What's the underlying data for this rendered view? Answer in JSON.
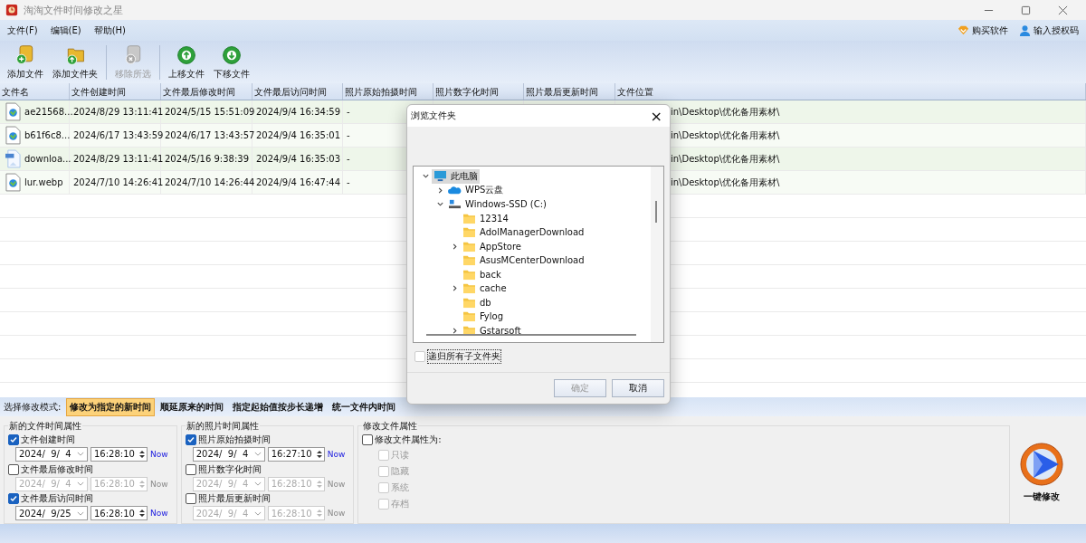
{
  "window": {
    "title": "淘淘文件时间修改之星"
  },
  "menu": [
    {
      "label": "文件(F)"
    },
    {
      "label": "编辑(E)"
    },
    {
      "label": "帮助(H)"
    }
  ],
  "menu_links": [
    {
      "kind": "buy",
      "label": "购买软件"
    },
    {
      "kind": "user",
      "label": "输入授权码"
    }
  ],
  "toolbar": [
    {
      "kind": "add-file",
      "label": "添加文件",
      "disabled": false
    },
    {
      "kind": "add-folder",
      "label": "添加文件夹",
      "disabled": false
    },
    {
      "kind": "remove",
      "label": "移除所选",
      "disabled": true
    },
    {
      "kind": "up",
      "label": "上移文件",
      "disabled": false
    },
    {
      "kind": "down",
      "label": "下移文件",
      "disabled": false
    }
  ],
  "table": {
    "columns": [
      "文件名",
      "文件创建时间",
      "文件最后修改时间",
      "文件最后访问时间",
      "照片原始拍摄时间",
      "照片数字化时间",
      "照片最后更新时间",
      "文件位置"
    ],
    "rows": [
      {
        "kind": "image",
        "name": "ae21568...",
        "created": "2024/8/29 13:11:41",
        "modified": "2024/5/15 15:51:09",
        "accessed": "2024/9/4 16:34:59",
        "photo_taken": "-",
        "location": "in\\Desktop\\优化备用素材\\"
      },
      {
        "kind": "image",
        "name": "b61f6c8...",
        "created": "2024/6/17 13:43:59",
        "modified": "2024/6/17 13:43:57",
        "accessed": "2024/9/4 16:35:01",
        "photo_taken": "-",
        "location": "in\\Desktop\\优化备用素材\\"
      },
      {
        "kind": "jpg",
        "name": "downloa...",
        "created": "2024/8/29 13:11:41",
        "modified": "2024/5/16 9:38:39",
        "accessed": "2024/9/4 16:35:03",
        "photo_taken": "-",
        "location": "in\\Desktop\\优化备用素材\\"
      },
      {
        "kind": "image",
        "name": "lur.webp",
        "created": "2024/7/10 14:26:41",
        "modified": "2024/7/10 14:26:44",
        "accessed": "2024/9/4 16:47:44",
        "photo_taken": "-",
        "location": "in\\Desktop\\优化备用素材\\"
      }
    ]
  },
  "dialog": {
    "title": "浏览文件夹",
    "close": "×",
    "tree": [
      {
        "kind": "computer",
        "label": "此电脑",
        "expanded": true,
        "selected": true,
        "children": [
          {
            "kind": "cloud",
            "label": "WPS云盘",
            "expanded": false,
            "selected": false
          },
          {
            "kind": "drive",
            "label": "Windows-SSD (C:)",
            "expanded": true,
            "selected": false,
            "children": [
              {
                "kind": "folder",
                "label": "12314",
                "selected": false
              },
              {
                "kind": "folder",
                "label": "AdolManagerDownload",
                "selected": false
              },
              {
                "kind": "folder",
                "label": "AppStore",
                "expanded": false,
                "selected": false
              },
              {
                "kind": "folder",
                "label": "AsusMCenterDownload",
                "selected": false
              },
              {
                "kind": "folder",
                "label": "back",
                "selected": false
              },
              {
                "kind": "folder",
                "label": "cache",
                "expanded": false,
                "selected": false
              },
              {
                "kind": "folder",
                "label": "db",
                "selected": false
              },
              {
                "kind": "folder",
                "label": "Fylog",
                "selected": false
              },
              {
                "kind": "folder",
                "label": "Gstarsoft",
                "expanded": false,
                "selected": false
              }
            ]
          }
        ]
      }
    ],
    "recursive": {
      "label": "递归所有子文件夹",
      "checked": false
    },
    "buttons": [
      {
        "label": "确定",
        "disabled": true
      },
      {
        "label": "取消",
        "disabled": false
      }
    ]
  },
  "mode_bar": {
    "label": "选择修改模式:",
    "modes": [
      {
        "label": "修改为指定的新时间",
        "selected": true
      },
      {
        "label": "顺延原来的时间",
        "selected": false
      },
      {
        "label": "指定起始值按步长递增",
        "selected": false
      },
      {
        "label": "统一文件内时间",
        "selected": false
      }
    ]
  },
  "file_times": {
    "title": "新的文件时间属性",
    "items": [
      {
        "label": "文件创建时间",
        "checked": true,
        "date": "2024/  9/  4",
        "time": "16:28:10",
        "now": "Now"
      },
      {
        "label": "文件最后修改时间",
        "checked": false,
        "date": "2024/  9/  4",
        "time": "16:28:10",
        "now": "Now"
      },
      {
        "label": "文件最后访问时间",
        "checked": true,
        "date": "2024/  9/25",
        "time": "16:28:10",
        "now": "Now"
      }
    ]
  },
  "photo_times": {
    "title": "新的照片时间属性",
    "items": [
      {
        "label": "照片原始拍摄时间",
        "checked": true,
        "date": "2024/  9/  4",
        "time": "16:27:10",
        "now": "Now"
      },
      {
        "label": "照片数字化时间",
        "checked": false,
        "date": "2024/  9/  4",
        "time": "16:28:10",
        "now": "Now"
      },
      {
        "label": "照片最后更新时间",
        "checked": false,
        "date": "2024/  9/  4",
        "time": "16:28:10",
        "now": "Now"
      }
    ]
  },
  "attributes": {
    "title": "修改文件属性",
    "main": {
      "label": "修改文件属性为:",
      "checked": false
    },
    "options": [
      {
        "label": "只读",
        "checked": false
      },
      {
        "label": "隐藏",
        "checked": false
      },
      {
        "label": "系统",
        "checked": false
      },
      {
        "label": "存档",
        "checked": false
      }
    ]
  },
  "run_button": {
    "label": "一键修改"
  }
}
